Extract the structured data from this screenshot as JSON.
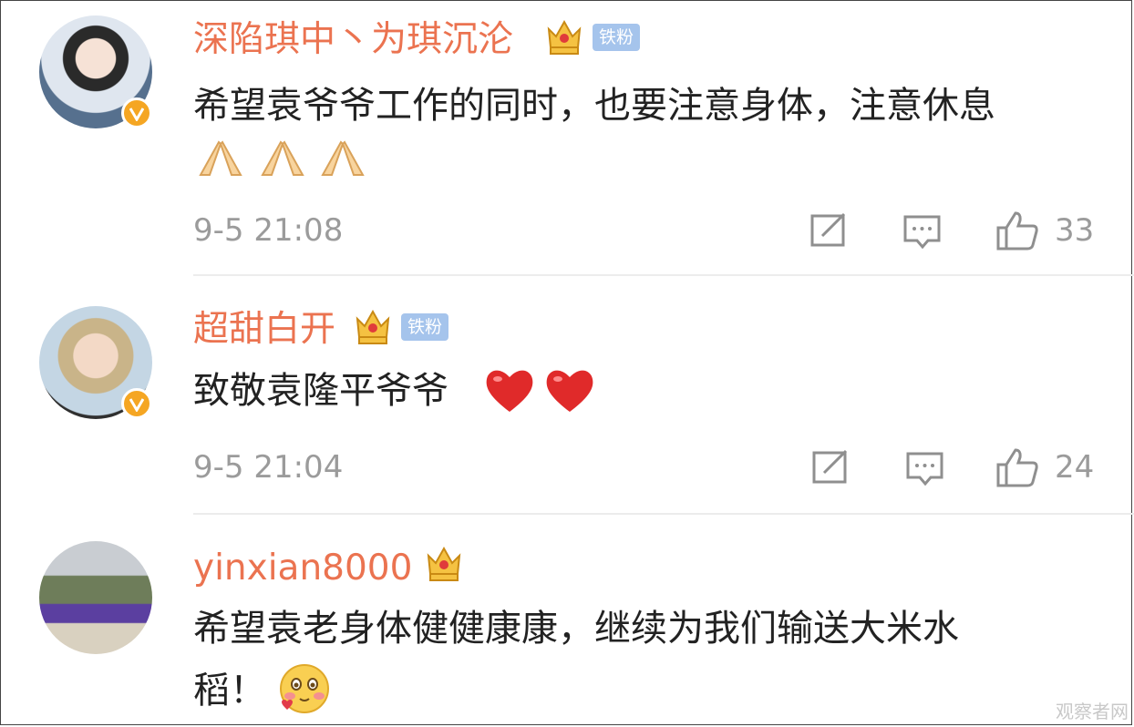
{
  "comments": [
    {
      "username": "深陷琪中丶为琪沉沦",
      "fan_badge": "铁粉",
      "text": "希望袁爷爷工作的同时，也要注意身体，注意休息",
      "emojis": [
        "pray-emoji",
        "pray-emoji",
        "pray-emoji"
      ],
      "time": "9-5 21:08",
      "likes": "33"
    },
    {
      "username": "超甜白开",
      "fan_badge": "铁粉",
      "text": "致敬袁隆平爷爷",
      "emojis": [
        "heart-emoji",
        "heart-emoji"
      ],
      "time": "9-5 21:04",
      "likes": "24"
    },
    {
      "username": "yinxian8000",
      "text_line1": "希望袁老身体健健康康，继续为我们输送大米水",
      "text_line2": "稻！",
      "emojis": [
        "blush-face-emoji"
      ]
    }
  ],
  "watermark": "观察者网",
  "colors": {
    "username": "#eb7350",
    "badge": "#a5c4ec",
    "vbadge": "#f5a623",
    "meta": "#9b9b9b"
  }
}
